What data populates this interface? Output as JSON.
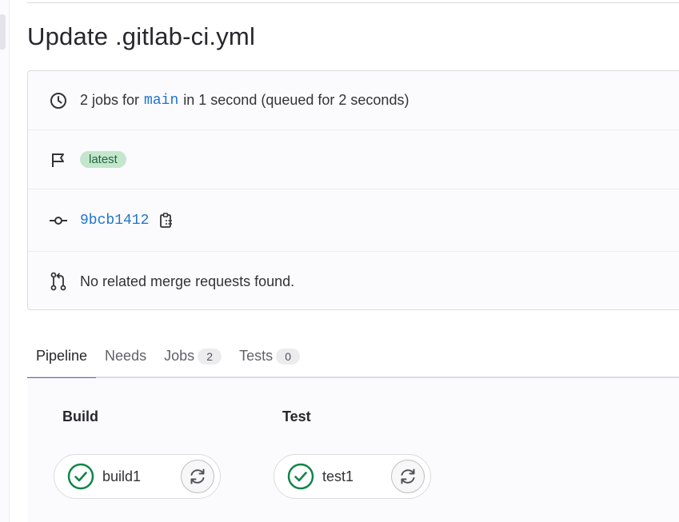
{
  "page": {
    "title": "Update .gitlab-ci.yml"
  },
  "info": {
    "jobs_prefix": "2 jobs for",
    "branch": "main",
    "jobs_suffix": "in 1 second (queued for 2 seconds)",
    "badge": "latest",
    "commit_sha": "9bcb1412",
    "merge_requests": "No related merge requests found."
  },
  "icons": {
    "clock": "clock-icon",
    "flag": "flag-icon",
    "commit": "commit-icon",
    "copy": "copy-to-clipboard-icon",
    "merge_request": "merge-request-icon",
    "success": "status-success-icon",
    "retry": "retry-icon"
  },
  "tabs": [
    {
      "label": "Pipeline",
      "count": null
    },
    {
      "label": "Needs",
      "count": null
    },
    {
      "label": "Jobs",
      "count": "2"
    },
    {
      "label": "Tests",
      "count": "0"
    }
  ],
  "stages": [
    {
      "title": "Build",
      "jobs": [
        {
          "name": "build1",
          "status": "success"
        }
      ]
    },
    {
      "title": "Test",
      "jobs": [
        {
          "name": "test1",
          "status": "success"
        }
      ]
    }
  ],
  "colors": {
    "link": "#1f75cb",
    "success": "#108548",
    "badge_bg": "#c3e6cd",
    "badge_text": "#24663b",
    "active_tab": "#6666c4"
  }
}
